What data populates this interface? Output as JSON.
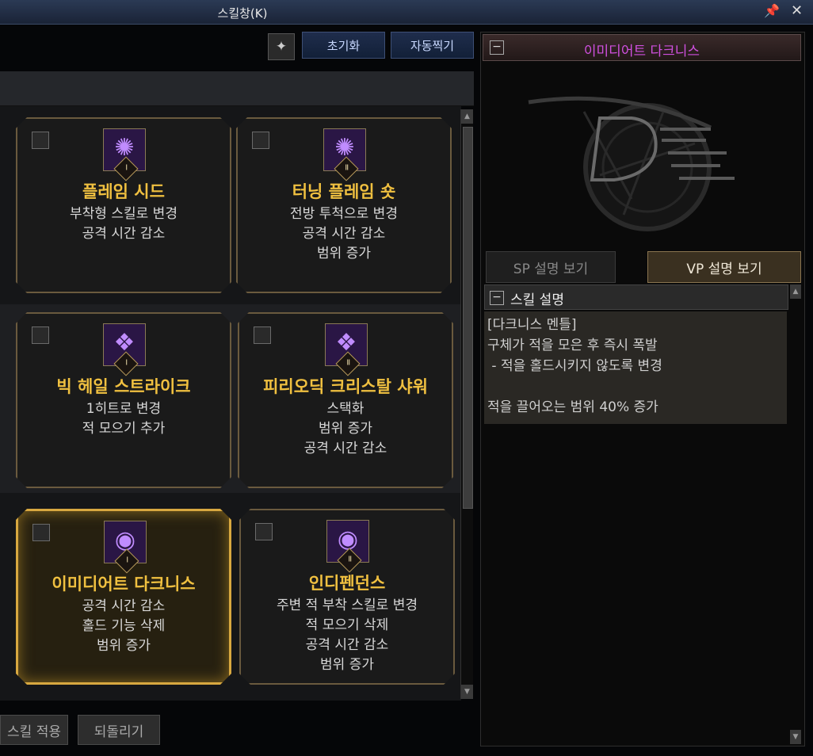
{
  "window": {
    "title": "스킬창(K)"
  },
  "toolbar": {
    "reset_label": "초기화",
    "auto_label": "자동찍기"
  },
  "cards": [
    {
      "name": "플레임 시드",
      "numeral": "Ⅰ",
      "icon": "flame-ring-icon",
      "lines": [
        "부착형 스킬로 변경",
        "공격 시간 감소"
      ]
    },
    {
      "name": "터닝 플레임 숏",
      "numeral": "Ⅱ",
      "icon": "flame-ring-icon",
      "lines": [
        "전방 투척으로 변경",
        "공격 시간 감소",
        "범위 증가"
      ]
    },
    {
      "name": "빅 헤일 스트라이크",
      "numeral": "Ⅰ",
      "icon": "crystal-shards-icon",
      "lines": [
        "1히트로 변경",
        "적 모으기 추가"
      ]
    },
    {
      "name": "피리오딕 크리스탈 샤워",
      "numeral": "Ⅱ",
      "icon": "crystal-shards-icon",
      "lines": [
        "스택화",
        "범위 증가",
        "공격 시간 감소"
      ]
    },
    {
      "name": "이미디어트 다크니스",
      "numeral": "Ⅰ",
      "icon": "dark-orb-icon",
      "lines": [
        "공격 시간 감소",
        "홀드 기능 삭제",
        "범위 증가"
      ]
    },
    {
      "name": "인디펜던스",
      "numeral": "Ⅱ",
      "icon": "dark-orb-icon",
      "lines": [
        "주변 적 부착 스킬로 변경",
        "적 모으기 삭제",
        "공격 시간 감소",
        "범위 증가"
      ]
    }
  ],
  "bottom": {
    "apply_label": "스킬 적용",
    "revert_label": "되돌리기"
  },
  "panel": {
    "title": "이미디어트 다크니스",
    "tabs": {
      "sp": "SP 설명 보기",
      "vp": "VP 설명 보기"
    },
    "section_label": "스킬 설명",
    "desc_lines": [
      "[다크니스 멘틀]",
      "구체가 적을 모은 후 즉시 폭발",
      " - 적을 홀드시키지 않도록 변경",
      "",
      "적을 끌어오는 범위 40% 증가"
    ]
  },
  "colors": {
    "title_gold": "#f0c040",
    "panel_title": "#d050e0",
    "selected_border": "#d8a840"
  }
}
